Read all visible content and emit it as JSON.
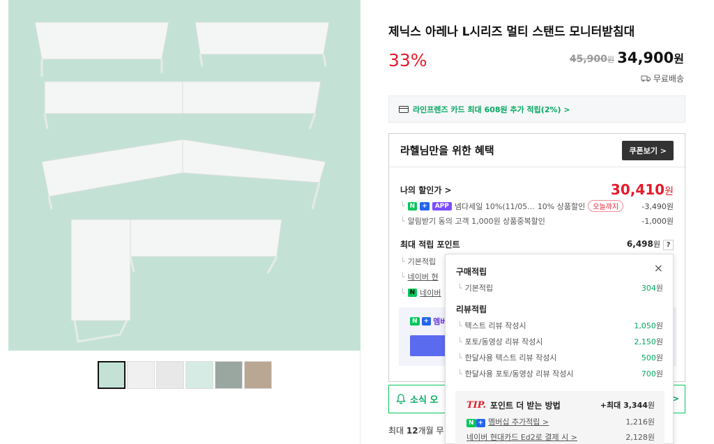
{
  "product": {
    "title": "제닉스 아레나 L시리즈 멀티 스탠드 모니터받침대",
    "discount": "33%",
    "original_price": "45,900",
    "original_unit": "원",
    "sale_price": "34,900",
    "sale_unit": "원",
    "shipping": "무료배송",
    "thumbnail_count": 6
  },
  "card_promo": {
    "text": "라인프렌즈 카드 최대 608원 추가 적립(2%) >"
  },
  "benefit": {
    "title": "라헬님만을 위한 혜택",
    "coupon_button": "쿠폰보기 >",
    "my_price_label": "나의 할인가 >",
    "my_price": "30,410",
    "my_price_unit": "원",
    "discount1_badges": [
      "N",
      "+",
      "APP"
    ],
    "discount1_text": "넴다세일 10%(11/05...",
    "discount1_extra": "10% 상품할인",
    "discount1_today": "오늘까지",
    "discount1_amount": "-3,490원",
    "discount2_text": "알림받기 동의 고객 1,000원 상품중복할인",
    "discount2_amount": "-1,000원",
    "points_label": "최대 적립 포인트",
    "points_value": "6,498",
    "points_unit": "원",
    "points_help": "?",
    "point_rows": [
      "기본적립",
      "네이버 현",
      "네이버"
    ],
    "member_badges": [
      "N",
      "+"
    ],
    "member_label": "멤버"
  },
  "notice": {
    "text": "소식 오",
    "arrow": ">"
  },
  "installment": {
    "prefix": "최대 ",
    "bold": "12",
    "suffix": "개월 무"
  },
  "popup": {
    "close": "×",
    "purchase_title": "구매적립",
    "purchase_rows": [
      {
        "label": "기본적립",
        "pts": "304",
        "unit": "원"
      }
    ],
    "review_title": "리뷰적립",
    "review_rows": [
      {
        "label": "텍스트 리뷰 작성시",
        "pts": "1,050",
        "unit": "원"
      },
      {
        "label": "포토/동영상 리뷰 작성시",
        "pts": "2,150",
        "unit": "원"
      },
      {
        "label": "한달사용 텍스트 리뷰 작성시",
        "pts": "500",
        "unit": "원"
      },
      {
        "label": "한달사용 포토/동영상 리뷰 작성시",
        "pts": "700",
        "unit": "원"
      }
    ],
    "tip_tag": "TIP.",
    "tip_title": "포인트 더 받는 방법",
    "tip_max_prefix": "+최대 ",
    "tip_max": "3,344",
    "tip_max_unit": "원",
    "tip_rows": [
      {
        "label": "멤버십 추가적립 >",
        "value": "1,216원"
      },
      {
        "label": "네이버 현대카드 Ed2로 결제 시 >",
        "value": "2,128원"
      }
    ]
  }
}
